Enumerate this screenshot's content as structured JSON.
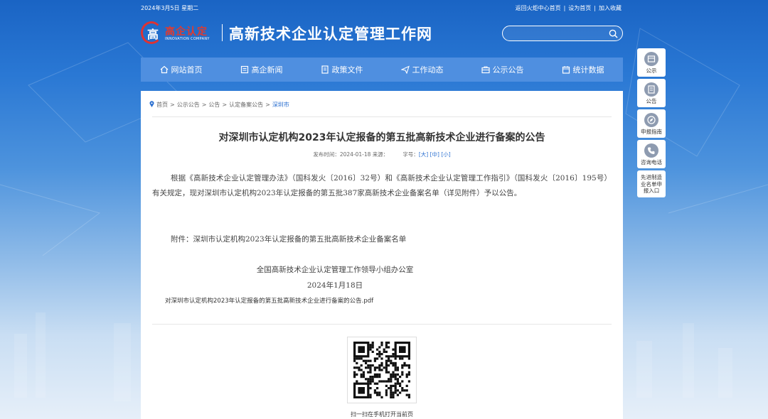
{
  "topbar": {
    "date": "2024年3月5日 星期二",
    "links": [
      "返回火炬中心首页",
      "设为首页",
      "加入收藏"
    ],
    "separator": "|"
  },
  "header": {
    "logo_text": "高企认定",
    "logo_sub": "INNOVATION COMPANY",
    "logo_mark": "高",
    "site_title": "高新技术企业认定管理工作网",
    "search_value": ""
  },
  "nav": {
    "items": [
      {
        "label": "网站首页",
        "icon": "home-icon"
      },
      {
        "label": "高企新闻",
        "icon": "news-icon"
      },
      {
        "label": "政策文件",
        "icon": "document-icon"
      },
      {
        "label": "工作动态",
        "icon": "send-icon"
      },
      {
        "label": "公示公告",
        "icon": "briefcase-icon"
      },
      {
        "label": "统计数据",
        "icon": "calendar-icon"
      }
    ]
  },
  "breadcrumb": {
    "items": [
      "首页",
      "公示公告",
      "公告",
      "认定备案公告"
    ],
    "current": "深圳市",
    "separator": ">"
  },
  "article": {
    "title": "对深圳市认定机构2023年认定报备的第五批高新技术企业进行备案的公告",
    "publish_label": "发布时间：2024-01-18 来源：",
    "font_label": "字号：",
    "font_sizes": [
      "[大]",
      "[中]",
      "[小]"
    ],
    "body": "根据《高新技术企业认定管理办法》（国科发火〔2016〕32号）和《高新技术企业认定管理工作指引》（国科发火〔2016〕195号）有关规定，现对深圳市认定机构2023年认定报备的第五批387家高新技术企业备案名单（详见附件）予以公告。",
    "attachment": "附件：深圳市认定机构2023年认定报备的第五批高新技术企业备案名单",
    "signature": "全国高新技术企业认定管理工作领导小组办公室",
    "sign_date": "2024年1月18日",
    "pdf_link": "对深圳市认定机构2023年认定报备的第五批高新技术企业进行备案的公告.pdf",
    "qr_caption": "扫一扫在手机打开当前页"
  },
  "sidebar": {
    "buttons": [
      {
        "label": "公示",
        "icon": "notice-icon"
      },
      {
        "label": "公告",
        "icon": "announcement-icon"
      },
      {
        "label": "申报指南",
        "icon": "compass-icon"
      },
      {
        "label": "咨询电话",
        "icon": "phone-icon"
      },
      {
        "label": "先进制造业名单申报入口",
        "icon": ""
      }
    ]
  },
  "colors": {
    "nav_bg": "#4f8fe0",
    "link": "#2a6fd0",
    "logo_red": "#e03a2f"
  }
}
